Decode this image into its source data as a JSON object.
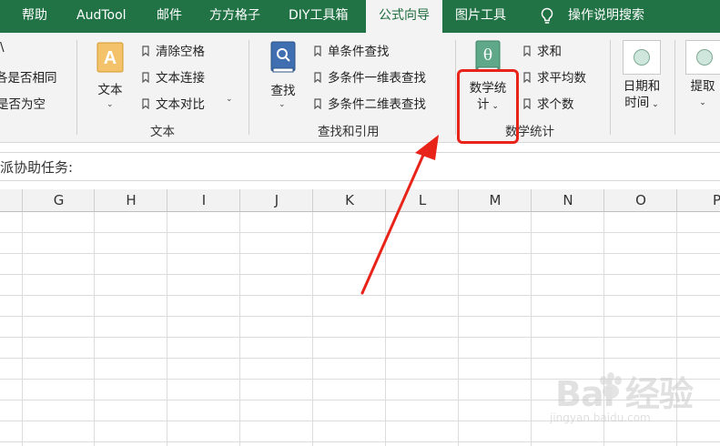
{
  "tabs": [
    {
      "label": "帮助"
    },
    {
      "label": "AudTool"
    },
    {
      "label": "邮件"
    },
    {
      "label": "方方格子"
    },
    {
      "label": "DIY工具箱"
    },
    {
      "label": "公式向导",
      "active": true
    },
    {
      "label": "图片工具"
    }
  ],
  "tell_me": {
    "label": "操作说明搜索",
    "icon": "lightbulb-icon"
  },
  "ribbon": {
    "group_left": {
      "items": [
        "\\",
        "是否相同",
        "是否为空"
      ],
      "partial_prefix": [
        "",
        "各",
        "是"
      ]
    },
    "group_text": {
      "big_button": {
        "label": "文本",
        "icon": "text-A-icon"
      },
      "items": [
        "清除空格",
        "文本连接",
        "文本对比"
      ],
      "label": "文本"
    },
    "group_lookup": {
      "big_button": {
        "label": "查找",
        "icon": "book-search-icon"
      },
      "items": [
        "单条件查找",
        "多条件一维表查找",
        "多条件二维表查找"
      ],
      "label": "查找和引用"
    },
    "group_stats": {
      "big_button": {
        "label_line1": "数学统",
        "label_line2": "计",
        "icon": "theta-book-icon",
        "glyph": "θ"
      },
      "items": [
        "求和",
        "求平均数",
        "求个数"
      ],
      "label": "数学统计"
    },
    "group_date": {
      "label_line1": "日期和",
      "label_line2": "时间"
    },
    "group_extract": {
      "label": "提取"
    }
  },
  "formula_bar": {
    "text": "派协助任务:"
  },
  "columns": [
    "G",
    "H",
    "I",
    "J",
    "K",
    "L",
    "M",
    "N",
    "O",
    "P"
  ],
  "watermark": {
    "line1": "Bai 经验",
    "line2": "jingyan.baidu.com"
  },
  "colors": {
    "tab_bg": "#217346",
    "highlight_red": "#e8231a",
    "ribbon_bg": "#f3f3f3"
  }
}
